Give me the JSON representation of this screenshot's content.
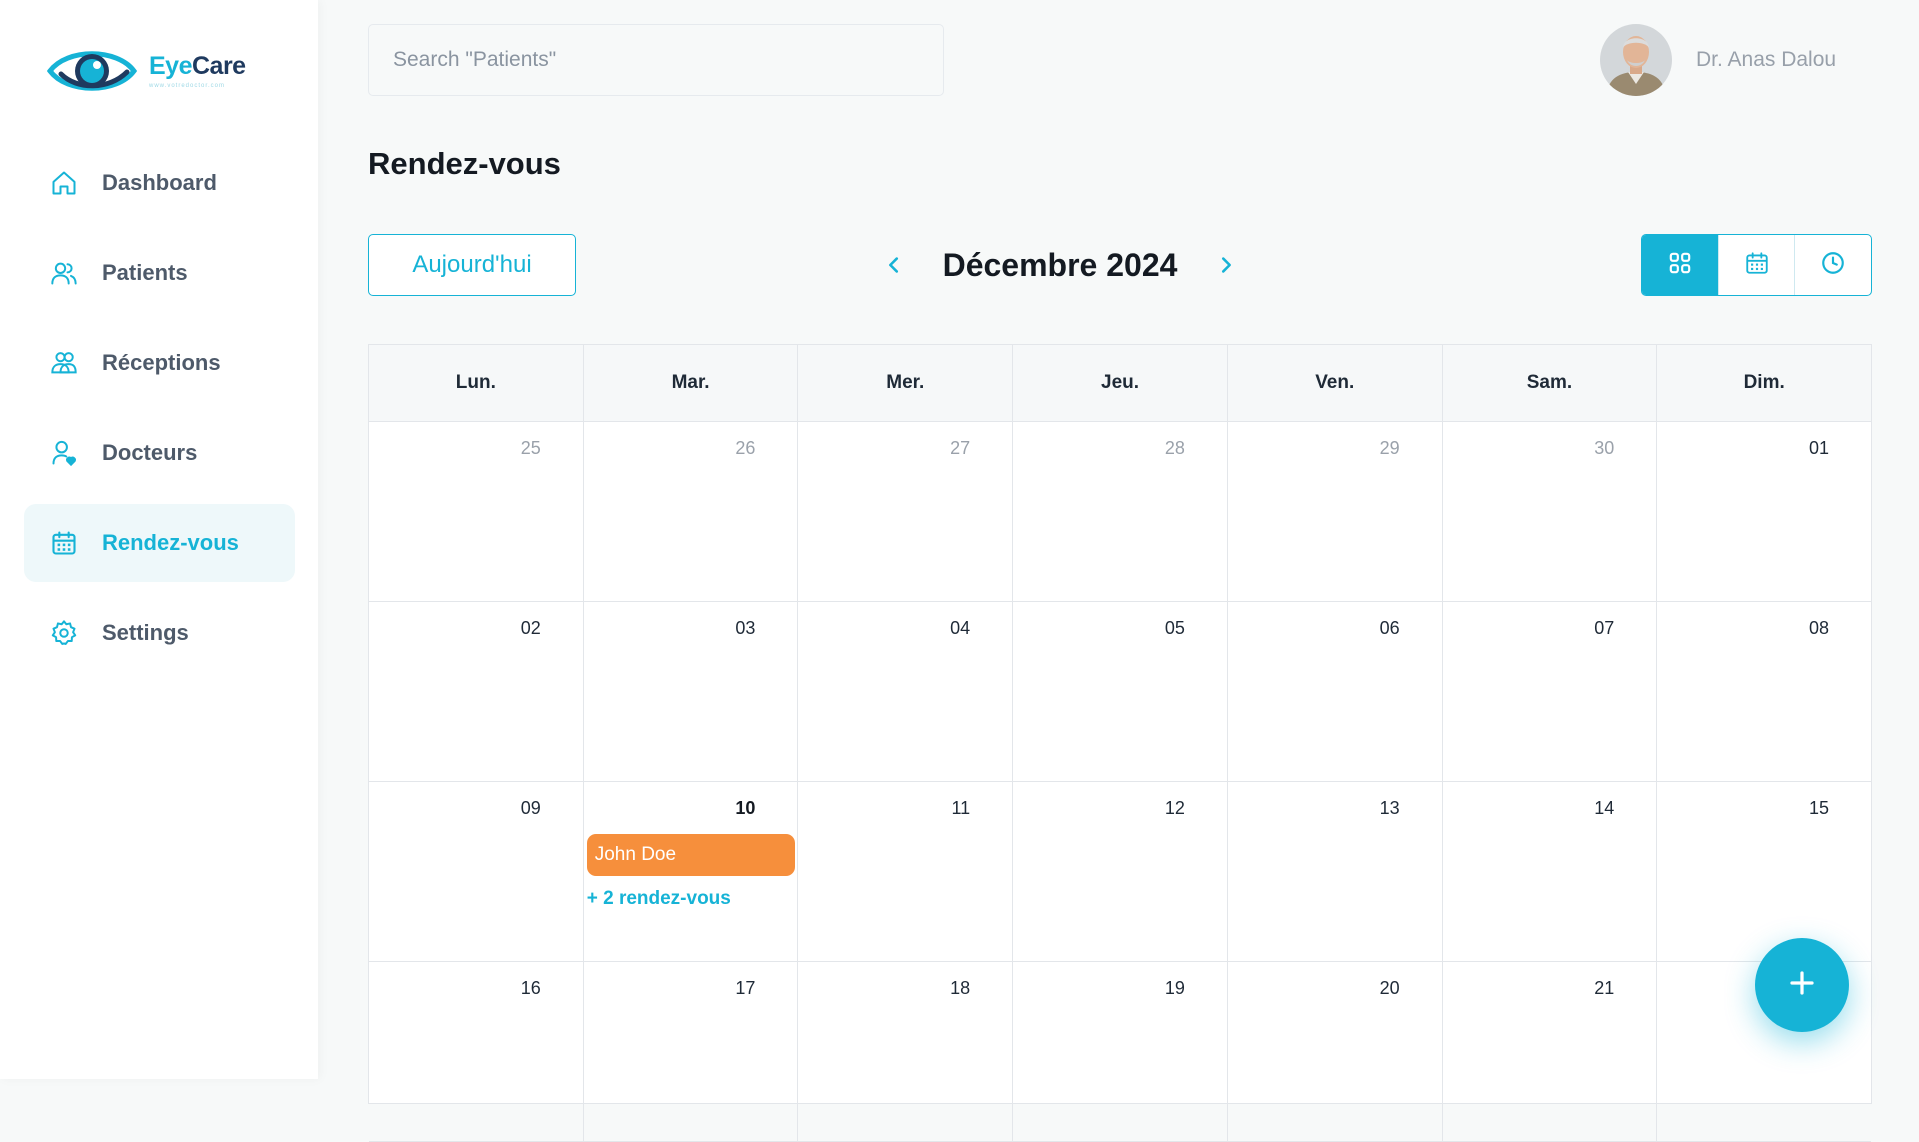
{
  "app": {
    "logo_part1": "Eye",
    "logo_part2": "Care",
    "logo_subtitle": "www.votredoctor.com"
  },
  "sidebar": {
    "items": [
      {
        "label": "Dashboard",
        "icon": "home-icon",
        "active": false
      },
      {
        "label": "Patients",
        "icon": "users-icon",
        "active": false
      },
      {
        "label": "Réceptions",
        "icon": "reception-icon",
        "active": false
      },
      {
        "label": "Docteurs",
        "icon": "doctor-icon",
        "active": false
      },
      {
        "label": "Rendez-vous",
        "icon": "calendar-icon",
        "active": true
      },
      {
        "label": "Settings",
        "icon": "gear-icon",
        "active": false
      }
    ]
  },
  "header": {
    "search_placeholder": "Search \"Patients\"",
    "user_name": "Dr. Anas Dalou"
  },
  "page": {
    "title": "Rendez-vous"
  },
  "toolbar": {
    "today_label": "Aujourd'hui",
    "month_label": "Décembre 2024",
    "views": [
      "grid-view-icon",
      "calendar-view-icon",
      "clock-view-icon"
    ],
    "active_view": 0
  },
  "calendar": {
    "weekdays": [
      "Lun.",
      "Mar.",
      "Mer.",
      "Jeu.",
      "Ven.",
      "Sam.",
      "Dim."
    ],
    "weeks": [
      [
        {
          "d": "25",
          "muted": true
        },
        {
          "d": "26",
          "muted": true
        },
        {
          "d": "27",
          "muted": true
        },
        {
          "d": "28",
          "muted": true
        },
        {
          "d": "29",
          "muted": true
        },
        {
          "d": "30",
          "muted": true
        },
        {
          "d": "01"
        }
      ],
      [
        {
          "d": "02"
        },
        {
          "d": "03"
        },
        {
          "d": "04"
        },
        {
          "d": "05"
        },
        {
          "d": "06"
        },
        {
          "d": "07"
        },
        {
          "d": "08"
        }
      ],
      [
        {
          "d": "09"
        },
        {
          "d": "10",
          "today": true,
          "event": "John Doe",
          "more": "+ 2 rendez-vous"
        },
        {
          "d": "11"
        },
        {
          "d": "12"
        },
        {
          "d": "13"
        },
        {
          "d": "14"
        },
        {
          "d": "15"
        }
      ],
      [
        {
          "d": "16"
        },
        {
          "d": "17"
        },
        {
          "d": "18"
        },
        {
          "d": "19"
        },
        {
          "d": "20"
        },
        {
          "d": "21"
        },
        {
          "d": ""
        }
      ]
    ]
  },
  "colors": {
    "accent": "#16b3d6",
    "event": "#f68f3c"
  }
}
